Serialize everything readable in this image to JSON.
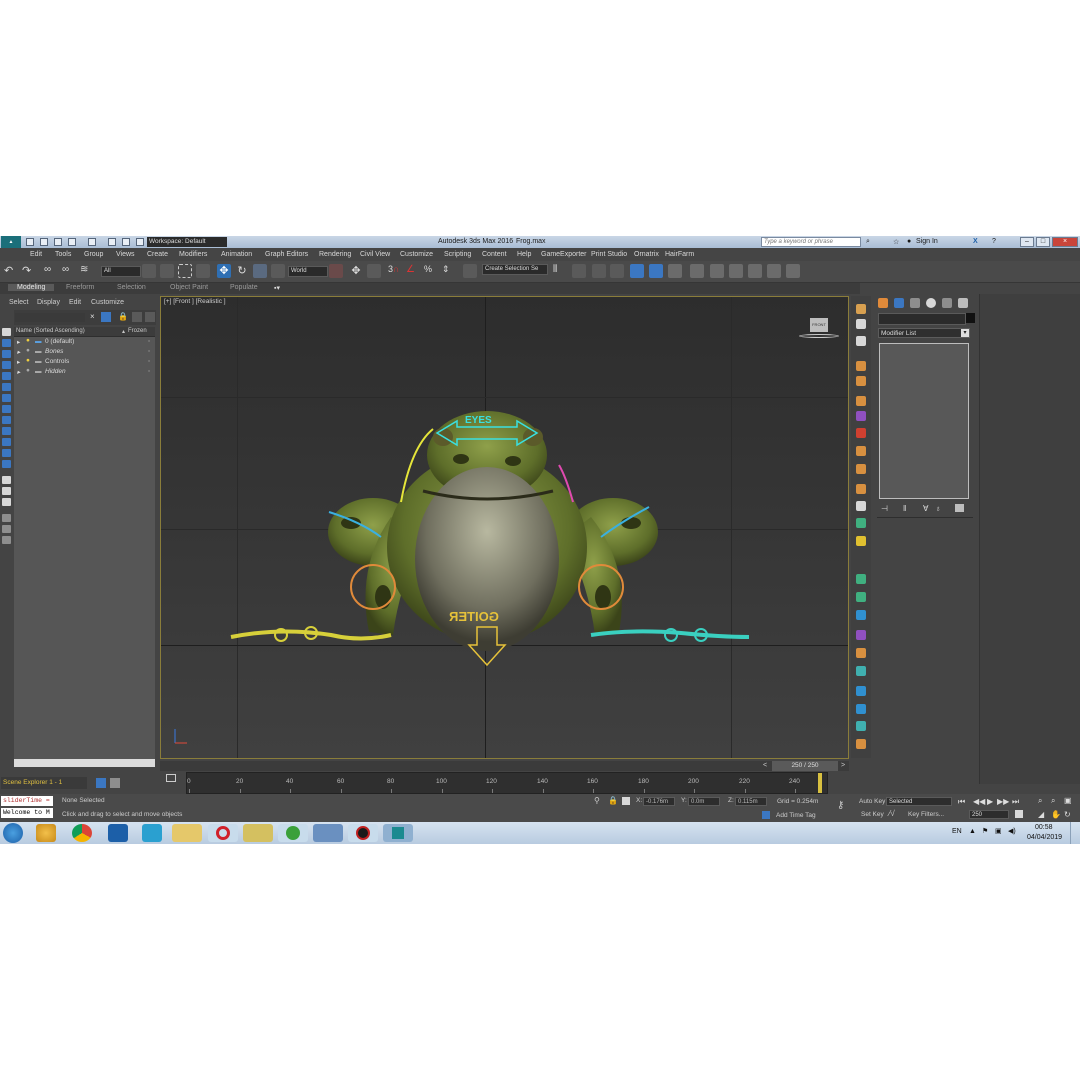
{
  "title_bar": {
    "workspace": "Workspace: Default",
    "app_title": "Autodesk 3ds Max 2016",
    "file_name": "Frog.max",
    "search_placeholder": "Type a keyword or phrase",
    "sign_in": "Sign In"
  },
  "menu": [
    "Edit",
    "Tools",
    "Group",
    "Views",
    "Create",
    "Modifiers",
    "Animation",
    "Graph Editors",
    "Rendering",
    "Civil View",
    "Customize",
    "Scripting",
    "Content",
    "Help",
    "GameExporter",
    "Print Studio",
    "Ornatrix",
    "HairFarm"
  ],
  "toolbar": {
    "filter": "All",
    "coord_system": "World",
    "named_selection": "Create Selection Se"
  },
  "ribbon_tabs": [
    "Modeling",
    "Freeform",
    "Selection",
    "Object Paint",
    "Populate"
  ],
  "scene_explorer": {
    "tabs": [
      "Select",
      "Display",
      "Edit",
      "Customize"
    ],
    "col_name": "Name (Sorted Ascending)",
    "col_frozen": "Frozen",
    "layers": [
      "0 (default)",
      "Bones",
      "Controls",
      "Hidden"
    ],
    "footer": "Scene Explorer 1 - 1"
  },
  "viewport": {
    "label": "[+] [Front ] [Realistic ]",
    "eyes_label": "EYES",
    "goiter_label": "GOITER",
    "viewcube": "FRONT"
  },
  "command_panel": {
    "modifier_list": "Modifier List"
  },
  "timeline": {
    "frame_display": "250 / 250",
    "ticks": [
      "0",
      "20",
      "40",
      "60",
      "80",
      "100",
      "120",
      "140",
      "160",
      "180",
      "200",
      "220",
      "240"
    ]
  },
  "status": {
    "listener_1": "sliderTime =",
    "listener_2": "Welcome to M",
    "selection": "None Selected",
    "prompt": "Click and drag to select and move objects",
    "x": "-0.176m",
    "y": "0.0m",
    "z": "0.115m",
    "grid": "Grid = 0.254m",
    "add_time_tag": "Add Time Tag",
    "auto_key": "Auto Key",
    "set_key": "Set Key",
    "key_mode": "Selected",
    "key_filters": "Key Filters...",
    "frame": "250"
  },
  "taskbar": {
    "language": "EN",
    "time": "00:58",
    "date": "04/04/2019"
  }
}
